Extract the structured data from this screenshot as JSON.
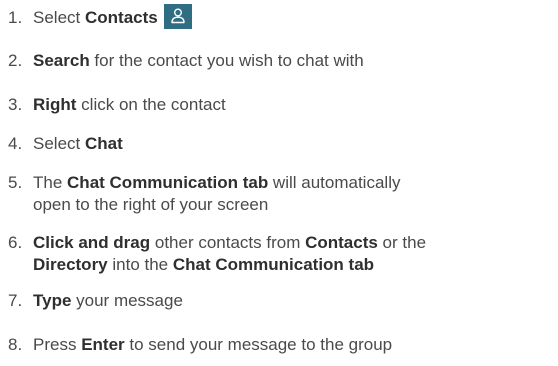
{
  "steps": [
    {
      "number": "1.",
      "parts": [
        {
          "text": "Select ",
          "bold": false
        },
        {
          "text": "Contacts",
          "bold": true
        }
      ],
      "icon": "contacts-icon"
    },
    {
      "number": "2.",
      "parts": [
        {
          "text": "Search",
          "bold": true
        },
        {
          "text": " for the contact you wish to chat with",
          "bold": false
        }
      ]
    },
    {
      "number": "3.",
      "parts": [
        {
          "text": "Right",
          "bold": true
        },
        {
          "text": " click on the contact",
          "bold": false
        }
      ]
    },
    {
      "number": "4.",
      "parts": [
        {
          "text": "Select ",
          "bold": false
        },
        {
          "text": "Chat",
          "bold": true
        }
      ]
    },
    {
      "number": "5.",
      "lines": [
        [
          {
            "text": "The ",
            "bold": false
          },
          {
            "text": "Chat Communication tab",
            "bold": true
          },
          {
            "text": " will automatically",
            "bold": false
          }
        ],
        [
          {
            "text": "open to the right of your screen",
            "bold": false
          }
        ]
      ]
    },
    {
      "number": "6.",
      "lines": [
        [
          {
            "text": "Click and drag",
            "bold": true
          },
          {
            "text": " other contacts from ",
            "bold": false
          },
          {
            "text": "Contacts",
            "bold": true
          },
          {
            "text": " or the",
            "bold": false
          }
        ],
        [
          {
            "text": "Directory",
            "bold": true
          },
          {
            "text": " into the ",
            "bold": false
          },
          {
            "text": "Chat Communication tab",
            "bold": true
          }
        ]
      ]
    },
    {
      "number": "7.",
      "parts": [
        {
          "text": "Type",
          "bold": true
        },
        {
          "text": " your message",
          "bold": false
        }
      ]
    },
    {
      "number": "8.",
      "parts": [
        {
          "text": "Press ",
          "bold": false
        },
        {
          "text": "Enter",
          "bold": true
        },
        {
          "text": " to send your message to the group",
          "bold": false
        }
      ]
    }
  ],
  "colors": {
    "text": "#4a4a4a",
    "bold_text": "#2f2f2f",
    "icon_background": "#2f6e82",
    "icon_foreground": "#ffffff"
  }
}
